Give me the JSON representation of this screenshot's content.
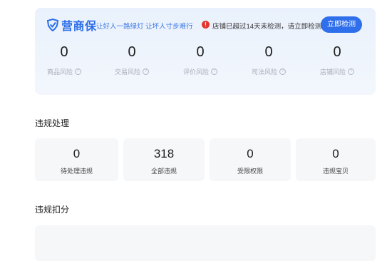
{
  "brand": {
    "name": "营商保",
    "slogan": "让好人一路绿灯 让坏人寸步难行",
    "accent": "#2f6fec"
  },
  "alert": {
    "icon": "exclamation-icon",
    "text": "店铺已超过14天未检测，请立即检测",
    "button_label": "立即检测"
  },
  "risk_metrics": [
    {
      "value": "0",
      "label": "商品风险"
    },
    {
      "value": "0",
      "label": "交易风险"
    },
    {
      "value": "0",
      "label": "评价风险"
    },
    {
      "value": "0",
      "label": "司法风险"
    },
    {
      "value": "0",
      "label": "店铺风险"
    }
  ],
  "violation": {
    "title": "违规处理",
    "cards": [
      {
        "value": "0",
        "label": "待处理违规"
      },
      {
        "value": "318",
        "label": "全部违规"
      },
      {
        "value": "0",
        "label": "受限权限"
      },
      {
        "value": "0",
        "label": "违规宝贝"
      }
    ]
  },
  "deduction": {
    "title": "违规扣分"
  },
  "icons": {
    "help": "question-circle-icon",
    "logo": "shield-check-icon"
  }
}
